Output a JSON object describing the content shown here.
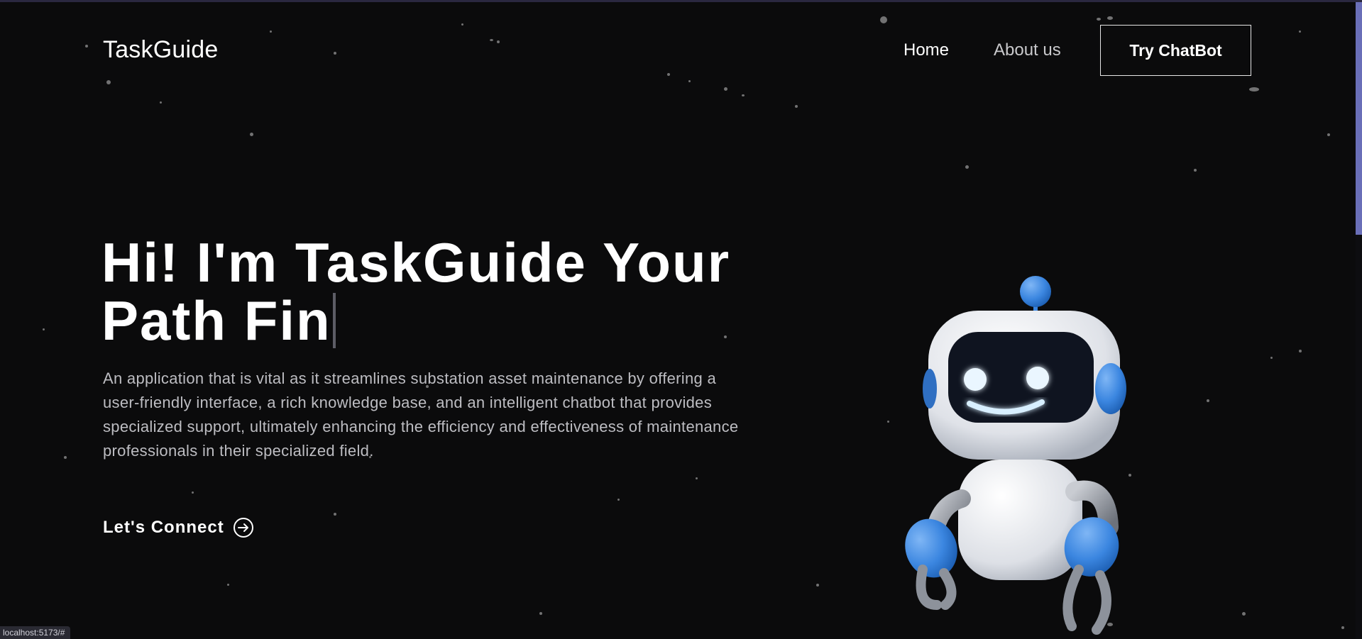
{
  "navbar": {
    "logo": "TaskGuide",
    "links": [
      {
        "label": "Home"
      },
      {
        "label": "About us"
      }
    ],
    "cta_label": "Try ChatBot"
  },
  "hero": {
    "title_line1": "Hi! I'm TaskGuide Your",
    "title_line2": "Path Fin",
    "description": "An application that is vital as it streamlines substation asset maintenance by offering a user-friendly interface, a rich knowledge base, and an intelligent chatbot that provides specialized support, ultimately enhancing the efficiency and effectiveness of maintenance professionals in their specialized field.",
    "connect_label": "Let's Connect",
    "connect_icon": "arrow-right-circle-icon"
  },
  "illustration": {
    "name": "robot-illustration",
    "accent_color": "#3b86e0",
    "body_color": "#e9ebf0"
  },
  "status_bar": {
    "url": "localhost:5173/#"
  },
  "colors": {
    "background": "#0b0b0c",
    "text": "#ffffff",
    "muted_text": "#bdbdc2",
    "scroll_thumb": "#6a6fb8"
  }
}
